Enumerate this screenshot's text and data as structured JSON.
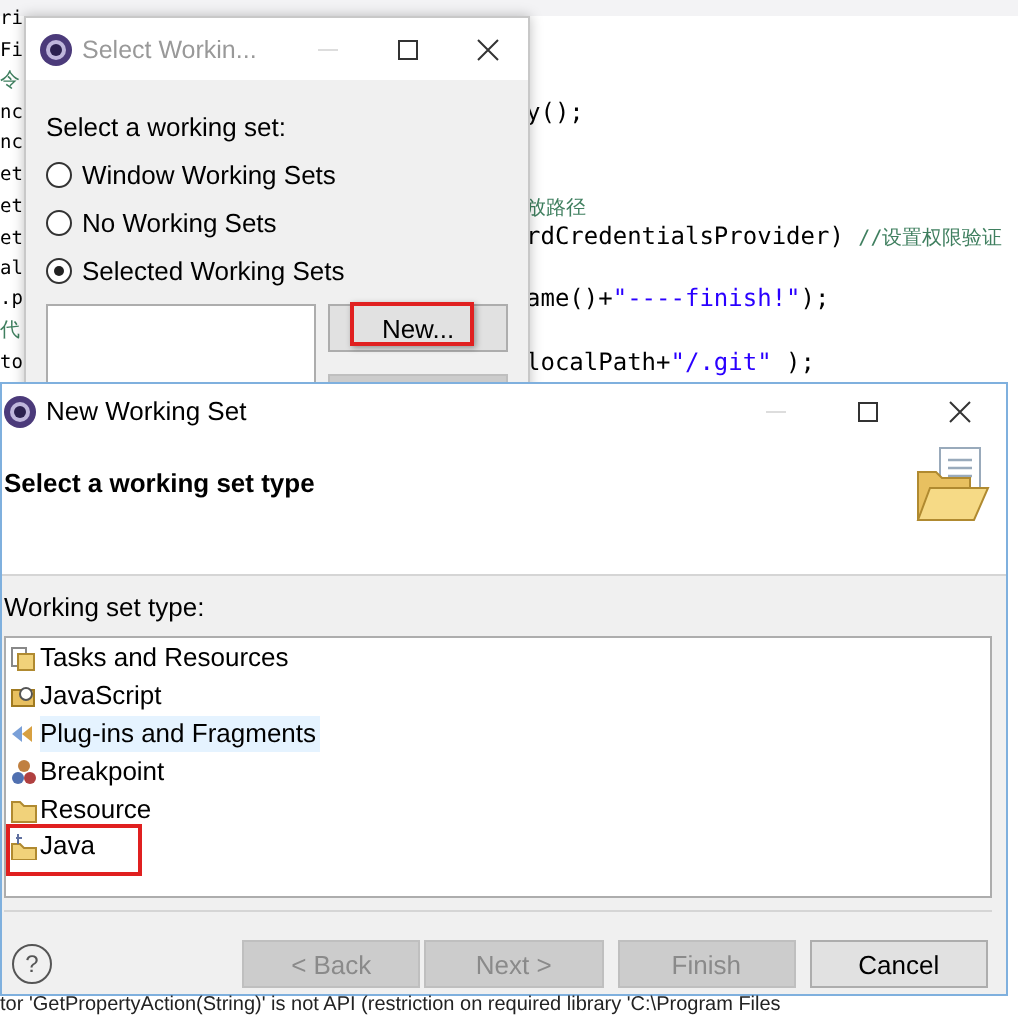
{
  "editor": {
    "lines": [
      {
        "left": [
          {
            "text": "ri",
            "kind": "code"
          }
        ]
      },
      {
        "left": [
          {
            "text": "Fi",
            "kind": "code"
          }
        ]
      },
      {
        "left": [
          {
            "text": "令",
            "kind": "comment"
          }
        ]
      },
      {
        "left": [
          {
            "text": "nc",
            "kind": "code"
          }
        ],
        "right": [
          {
            "text": "y();",
            "kind": "code"
          }
        ]
      },
      {
        "left": [
          {
            "text": "nc",
            "kind": "code"
          }
        ]
      },
      {
        "left": [
          {
            "text": "et",
            "kind": "code"
          }
        ]
      },
      {
        "left": [
          {
            "text": "et",
            "kind": "code"
          }
        ],
        "right": [
          {
            "text": "放路径",
            "kind": "comment"
          }
        ]
      },
      {
        "left": [
          {
            "text": "et",
            "kind": "code"
          }
        ],
        "right": [
          {
            "text": "rdCredentialsProvider) ",
            "kind": "code"
          },
          {
            "text": "//设置权限验证",
            "kind": "comment"
          }
        ]
      },
      {
        "left": [
          {
            "text": "al",
            "kind": "code"
          }
        ]
      },
      {
        "left": [
          {
            "text": ".p",
            "kind": "code"
          }
        ],
        "right": [
          {
            "text": "ame()+",
            "kind": "code"
          },
          {
            "text": "\"----finish!\"",
            "kind": "string"
          },
          {
            "text": ");",
            "kind": "code"
          }
        ]
      },
      {
        "left": [
          {
            "text": "代",
            "kind": "comment"
          }
        ]
      },
      {
        "left": [
          {
            "text": "to",
            "kind": "code"
          }
        ],
        "right": [
          {
            "text": "localPath+",
            "kind": "code"
          },
          {
            "text": "\"/.git\"",
            "kind": "string"
          },
          {
            "text": " );",
            "kind": "code"
          }
        ]
      }
    ],
    "problem_line": "tor 'GetPropertyAction(String)' is not API (restriction on required library 'C:\\Program Files"
  },
  "select_dialog": {
    "title": "Select Workin...",
    "prompt": "Select a working set:",
    "options": [
      {
        "label": "Window Working Sets",
        "selected": false
      },
      {
        "label": "No Working Sets",
        "selected": false
      },
      {
        "label": "Selected Working Sets",
        "selected": true
      }
    ],
    "new_button": {
      "label": "New...",
      "highlighted": true
    },
    "edit_button": {
      "disabled": true
    }
  },
  "new_dialog": {
    "title": "New Working Set",
    "help_label": "?",
    "heading": "Select a working set type",
    "list_label": "Working set type:",
    "types": [
      {
        "label": "Tasks and Resources",
        "kind": "tasks",
        "selected": false,
        "highlighted": false
      },
      {
        "label": "JavaScript",
        "kind": "javascript",
        "selected": false,
        "highlighted": false
      },
      {
        "label": "Plug-ins and Fragments",
        "kind": "plugin",
        "selected": true,
        "highlighted": false
      },
      {
        "label": "Breakpoint",
        "kind": "breakpoint",
        "selected": false,
        "highlighted": false
      },
      {
        "label": "Resource",
        "kind": "resource",
        "selected": false,
        "highlighted": false
      },
      {
        "label": "Java",
        "kind": "java",
        "selected": false,
        "highlighted": true
      }
    ],
    "buttons": [
      {
        "label": "< Back",
        "disabled": true
      },
      {
        "label": "Next >",
        "disabled": true
      },
      {
        "label": "Finish",
        "disabled": true
      },
      {
        "label": "Cancel",
        "disabled": false
      }
    ]
  }
}
